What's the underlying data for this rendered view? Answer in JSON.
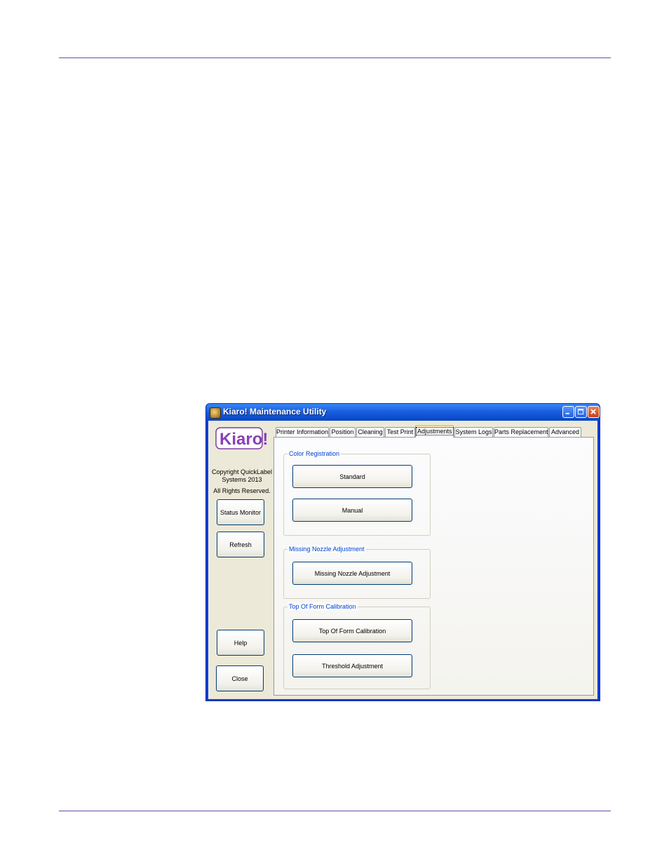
{
  "window": {
    "title": "Kiaro! Maintenance Utility",
    "logo_text": "Kiaro!"
  },
  "sidebar": {
    "copyright_line1": "Copyright QuickLabel",
    "copyright_line2": "Systems 2013",
    "copyright_line3": "All Rights Reserved.",
    "status_monitor_label": "Status Monitor",
    "refresh_label": "Refresh",
    "help_label": "Help",
    "close_label": "Close"
  },
  "tabs": [
    {
      "label": "Printer Information"
    },
    {
      "label": "Position"
    },
    {
      "label": "Cleaning"
    },
    {
      "label": "Test Print"
    },
    {
      "label": "Adjustments",
      "active": true
    },
    {
      "label": "System Logs"
    },
    {
      "label": "Parts Replacement"
    },
    {
      "label": "Advanced"
    }
  ],
  "groups": {
    "color_registration": {
      "title": "Color Registration",
      "standard_label": "Standard",
      "manual_label": "Manual"
    },
    "missing_nozzle": {
      "title": "Missing Nozzle Adjustment",
      "button_label": "Missing Nozzle Adjustment"
    },
    "top_of_form": {
      "title": "Top Of Form Calibration",
      "calibration_label": "Top Of Form Calibration",
      "threshold_label": "Threshold Adjustment"
    }
  },
  "colors": {
    "rule": "#6b4aa8",
    "titlebar": "#0c4ed0",
    "group_title": "#0046d5",
    "active_tab_accent": "#ffc73c"
  }
}
